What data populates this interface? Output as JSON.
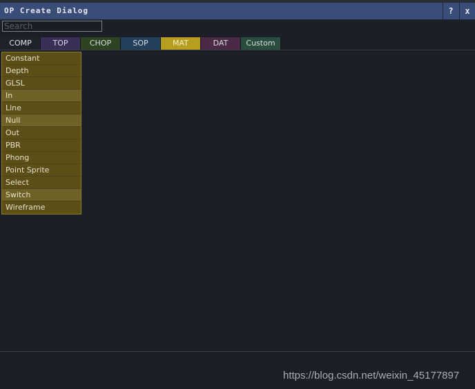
{
  "window": {
    "title": "OP Create Dialog",
    "help_label": "?",
    "close_label": "x"
  },
  "search": {
    "placeholder": "Search",
    "value": ""
  },
  "tabs": [
    {
      "label": "COMP",
      "color": "#1f2229"
    },
    {
      "label": "TOP",
      "color": "#3a2f57"
    },
    {
      "label": "CHOP",
      "color": "#2c4422"
    },
    {
      "label": "SOP",
      "color": "#24405d"
    },
    {
      "label": "MAT",
      "color": "#b89e20",
      "selected": true
    },
    {
      "label": "DAT",
      "color": "#4a2a44"
    },
    {
      "label": "Custom",
      "color": "#2a4e3e"
    }
  ],
  "operators": [
    {
      "label": "Constant"
    },
    {
      "label": "Depth"
    },
    {
      "label": "GLSL"
    },
    {
      "label": "In"
    },
    {
      "label": "Line"
    },
    {
      "label": "Null"
    },
    {
      "label": "Out"
    },
    {
      "label": "PBR"
    },
    {
      "label": "Phong"
    },
    {
      "label": "Point Sprite"
    },
    {
      "label": "Select"
    },
    {
      "label": "Switch"
    },
    {
      "label": "Wireframe"
    }
  ],
  "watermark": "https://blog.csdn.net/weixin_45177897"
}
